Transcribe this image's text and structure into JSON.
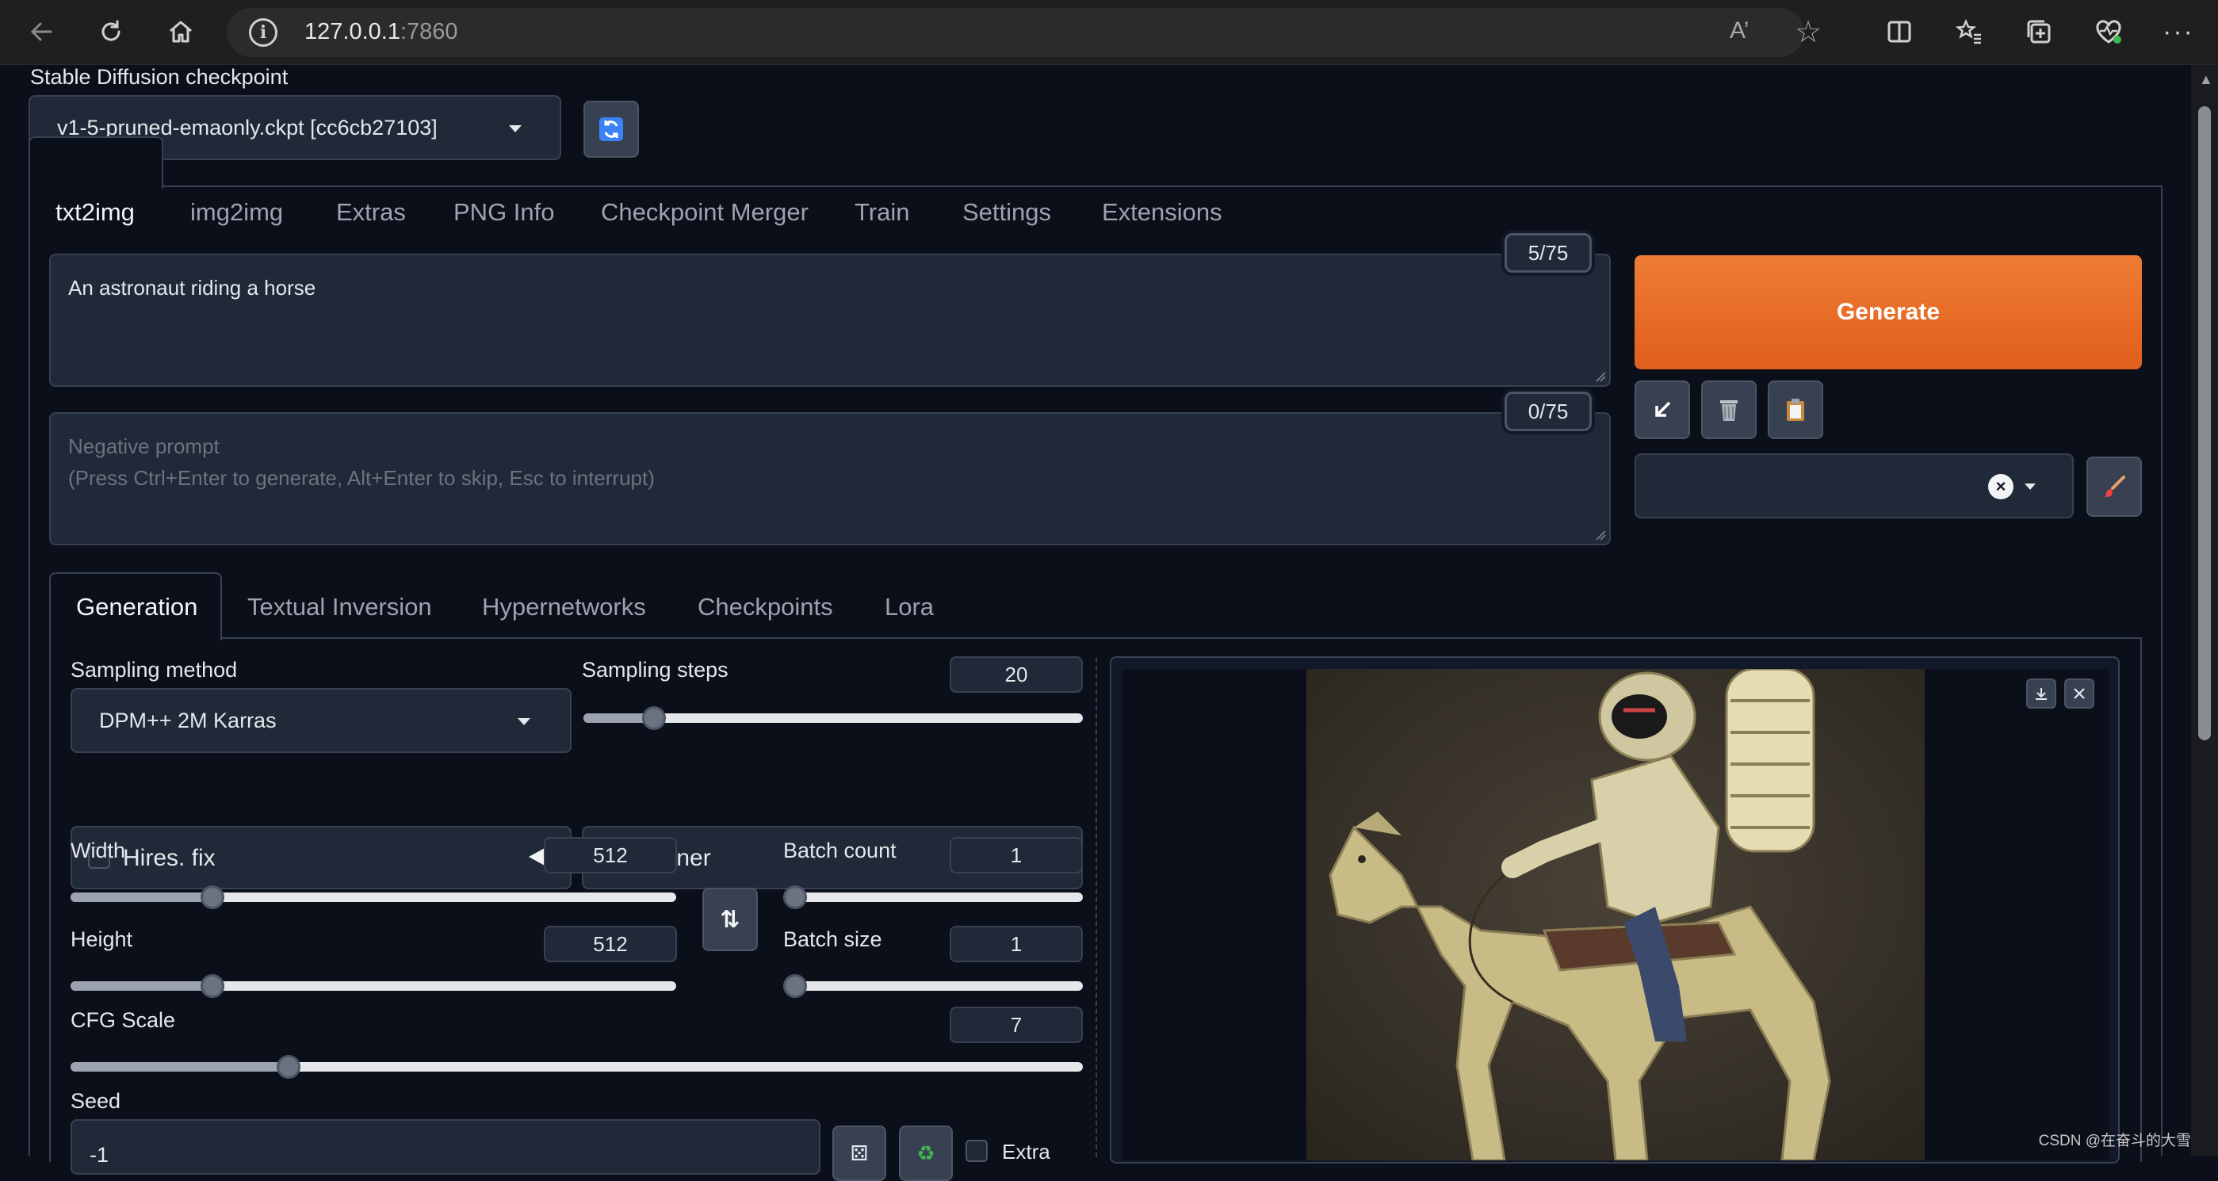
{
  "browser": {
    "url_host": "127.0.0.1",
    "url_port": ":7860"
  },
  "checkpoint": {
    "label": "Stable Diffusion checkpoint",
    "value": "v1-5-pruned-emaonly.ckpt [cc6cb27103]"
  },
  "main_tabs": [
    "txt2img",
    "img2img",
    "Extras",
    "PNG Info",
    "Checkpoint Merger",
    "Train",
    "Settings",
    "Extensions"
  ],
  "prompt": {
    "value": "An astronaut riding a horse",
    "counter": "5/75"
  },
  "negative_prompt": {
    "placeholder_line1": "Negative prompt",
    "placeholder_line2": "(Press Ctrl+Enter to generate, Alt+Enter to skip, Esc to interrupt)",
    "counter": "0/75"
  },
  "generate_label": "Generate",
  "sub_tabs": [
    "Generation",
    "Textual Inversion",
    "Hypernetworks",
    "Checkpoints",
    "Lora"
  ],
  "sampling": {
    "method_label": "Sampling method",
    "method_value": "DPM++ 2M Karras",
    "steps_label": "Sampling steps",
    "steps_value": "20"
  },
  "hires_label": "Hires. fix",
  "refiner_label": "Refiner",
  "width": {
    "label": "Width",
    "value": "512"
  },
  "height": {
    "label": "Height",
    "value": "512"
  },
  "batch_count": {
    "label": "Batch count",
    "value": "1"
  },
  "batch_size": {
    "label": "Batch size",
    "value": "1"
  },
  "cfg": {
    "label": "CFG Scale",
    "value": "7"
  },
  "seed": {
    "label": "Seed",
    "value": "-1",
    "extra_label": "Extra"
  },
  "watermark": "CSDN @在奋斗的大雪",
  "colors": {
    "generate": "#ea6a23",
    "background": "#0b0f19",
    "panel": "#1f2937"
  }
}
